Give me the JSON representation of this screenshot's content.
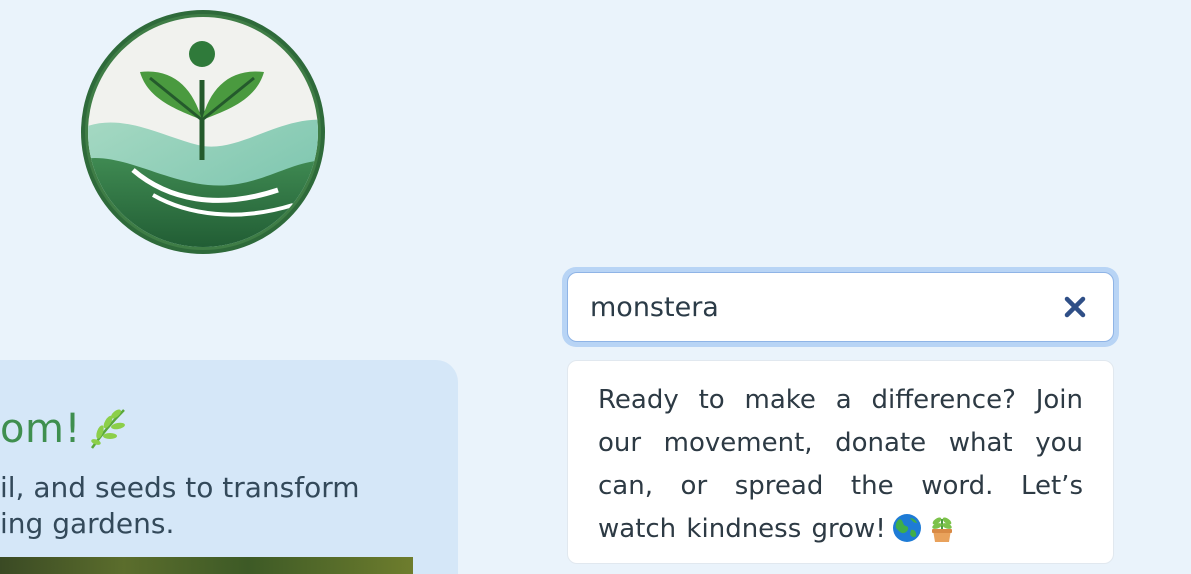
{
  "hero": {
    "title": "om!",
    "description_line1": "il, and seeds to transform",
    "description_line2": "ing gardens."
  },
  "search": {
    "value": "monstera"
  },
  "suggestion": {
    "text": "Ready to make a difference? Join our movement, donate what you can, or spread the word. Let’s watch kindness grow!"
  },
  "icons": {
    "logo": "plant-sprout-logo",
    "title_icon": "herb-leaf-icon",
    "clear": "close-icon",
    "emoji1": "globe-icon",
    "emoji2": "potted-plant-icon"
  },
  "colors": {
    "background": "#eaf3fb",
    "card": "#d5e7f8",
    "accent_green": "#3f8f4f",
    "focus_ring": "#b8d4f5",
    "clear_icon": "#2f4f87"
  }
}
